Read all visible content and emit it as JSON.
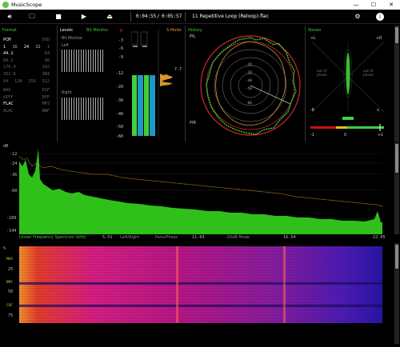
{
  "window": {
    "title": "MusicScope",
    "controls": [
      "—",
      "☐",
      "✕"
    ]
  },
  "toolbar": {
    "time_elapsed": "0:04:55",
    "time_sep": "/",
    "time_total": "0:05:57",
    "track": "11 Repetitive Loop (Reloop).flac"
  },
  "format_panel": {
    "title": "Format",
    "header": [
      "PCM",
      "DSD"
    ],
    "rows": [
      [
        "1",
        "16",
        "24",
        "32",
        "1"
      ],
      [
        "44.1",
        "",
        "",
        "",
        "64"
      ],
      [
        "88.2",
        "",
        "",
        "",
        "96"
      ],
      [
        "176.4",
        "",
        "",
        "",
        "192"
      ],
      [
        "352.8",
        "",
        "",
        "",
        "384"
      ],
      [
        "64",
        "128",
        "256",
        "512",
        ""
      ]
    ],
    "formats_left": [
      "WAV",
      "AIFF",
      "FLAC",
      "ALAC"
    ],
    "formats_right": [
      "DSF",
      "DFF",
      "MP3",
      "BWF"
    ]
  },
  "levels_panel": {
    "title": "Levels",
    "subtitle": "Bit Monitor",
    "bit_monitor_label": "Bit Monitor",
    "left_label": "Left",
    "right_label": "Right",
    "scale_top": [
      "0",
      "-3",
      "-6",
      "-9"
    ],
    "scale_main": [
      "-12",
      "-20",
      "-30",
      "-40",
      "-50",
      "-60"
    ],
    "s_mode": "S-Mode",
    "peak_value": "7.7",
    "channel_labels": [
      "LL",
      "LU"
    ]
  },
  "history_panel": {
    "title": "History",
    "l_label": "PfL",
    "r_label": "PfR",
    "rings": [
      "-20",
      "-30",
      "-40",
      "-50",
      "-60"
    ]
  },
  "stereo_panel": {
    "title": "Stereo",
    "top_left": "+L",
    "top_right": "+R",
    "bottom_left": "-R",
    "bottom_right": "-L",
    "out_left": "out of phase",
    "out_right": "out of phase",
    "corr_left": "-1",
    "corr_mid": "0",
    "corr_right": "+1"
  },
  "spectrum": {
    "db_label": "dB",
    "y_ticks": [
      "-12",
      "-24",
      "-36",
      "-60",
      "-100",
      "-144"
    ],
    "x_ticks": [
      "5.51",
      "11.03",
      "16.54",
      "22.05"
    ],
    "footer_title": "Linear Frequency Spectrum (kHz)",
    "footer_mode1": "Left/Right",
    "footer_mode2": "Pans/Phase",
    "footer_mode3": "-20dB Mode"
  },
  "spectrogram": {
    "y_label": "%",
    "y_ticks": [
      "25",
      "50",
      "75"
    ],
    "side_labels": [
      "MAX",
      "BRY",
      "COF"
    ]
  },
  "colors": {
    "accent_green": "#44cc33",
    "spectrum_fill": "#2fc11a",
    "peak_line": "#d9962e",
    "meter_blue": "#1c98c8",
    "history_ring": "#cc2a2a"
  }
}
